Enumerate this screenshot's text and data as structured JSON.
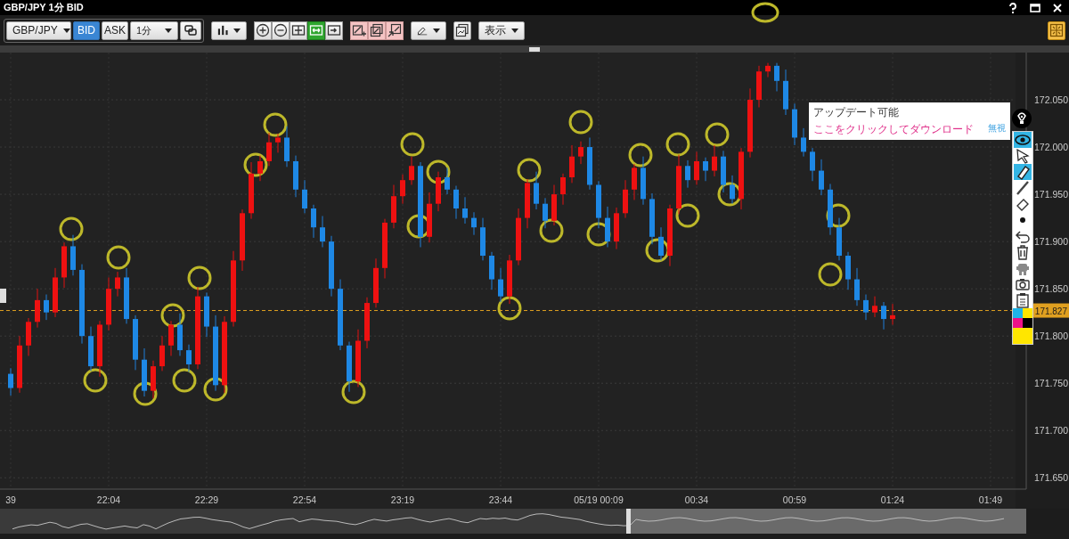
{
  "window": {
    "title": "GBP/JPY 1分 BID"
  },
  "toolbar": {
    "symbol": "GBP/JPY",
    "price_sides": [
      {
        "label": "BID",
        "selected": true
      },
      {
        "label": "ASK",
        "selected": false
      }
    ],
    "timeframe": "1分",
    "view_buttons": [
      {
        "selected": false
      },
      {
        "selected": false
      },
      {
        "selected": false
      },
      {
        "selected": true
      },
      {
        "selected": false
      }
    ],
    "display_menu": "表示"
  },
  "notification": {
    "title": "アップデート可能",
    "link": "ここをクリックしてダウンロード",
    "dismiss": "無視"
  },
  "drawing_tools": [
    {
      "selected": true
    },
    {
      "selected": false
    },
    {
      "selected": true
    },
    {
      "selected": false
    },
    {
      "selected": false
    },
    {
      "selected": false
    },
    {
      "selected": false
    },
    {
      "selected": false
    },
    {
      "selected": false
    },
    {
      "selected": false
    },
    {
      "selected": false
    }
  ],
  "chart": {
    "chart_data": {
      "type": "candlestick",
      "ylim": [
        171.638,
        172.1
      ],
      "grid": true,
      "ref_lines": [
        {
          "axis": "y",
          "value": 171.827,
          "label": "171.827",
          "color": "#e0a020"
        }
      ],
      "categories": [
        "39",
        null,
        null,
        null,
        null,
        null,
        null,
        null,
        null,
        null,
        null,
        "22:04",
        null,
        null,
        null,
        null,
        null,
        null,
        null,
        null,
        null,
        null,
        "22:29",
        null,
        null,
        null,
        null,
        null,
        null,
        null,
        null,
        null,
        null,
        "22:54",
        null,
        null,
        null,
        null,
        null,
        null,
        null,
        null,
        null,
        null,
        "23:19",
        null,
        null,
        null,
        null,
        null,
        null,
        null,
        null,
        null,
        null,
        "23:44",
        null,
        null,
        null,
        null,
        null,
        null,
        null,
        null,
        null,
        null,
        "05/19 00:09",
        null,
        null,
        null,
        null,
        null,
        null,
        null,
        null,
        null,
        null,
        "00:34",
        null,
        null,
        null,
        null,
        null,
        null,
        null,
        null,
        null,
        null,
        "00:59",
        null,
        null,
        null,
        null,
        null,
        null,
        null,
        null,
        null,
        null,
        "01:24",
        null,
        null,
        null,
        null,
        null,
        null,
        null,
        null,
        null,
        null,
        "01:49"
      ],
      "yticks": [
        {
          "value": 172.05,
          "label": "172.050"
        },
        {
          "value": 172.0,
          "label": "172.000"
        },
        {
          "value": 171.95,
          "label": "171.950"
        },
        {
          "value": 171.9,
          "label": "171.900"
        },
        {
          "value": 171.85,
          "label": "171.850"
        },
        {
          "value": 171.8,
          "label": "171.800"
        },
        {
          "value": 171.75,
          "label": "171.750"
        },
        {
          "value": 171.7,
          "label": "171.700"
        },
        {
          "value": 171.65,
          "label": "171.650"
        }
      ],
      "ohlc": [
        [
          171.76,
          171.766,
          171.737,
          171.745
        ],
        [
          171.745,
          171.8,
          171.74,
          171.79
        ],
        [
          171.79,
          171.819,
          171.779,
          171.815
        ],
        [
          171.815,
          171.85,
          171.809,
          171.838
        ],
        [
          171.838,
          171.844,
          171.817,
          171.825
        ],
        [
          171.825,
          171.872,
          171.82,
          171.862
        ],
        [
          171.862,
          171.899,
          171.851,
          171.895
        ],
        [
          171.895,
          171.907,
          171.864,
          171.87
        ],
        [
          171.87,
          171.876,
          171.792,
          171.8
        ],
        [
          171.8,
          171.81,
          171.763,
          171.768
        ],
        [
          171.768,
          171.816,
          171.757,
          171.812
        ],
        [
          171.812,
          171.862,
          171.806,
          171.85
        ],
        [
          171.85,
          171.868,
          171.842,
          171.862
        ],
        [
          171.862,
          171.872,
          171.813,
          171.818
        ],
        [
          171.818,
          171.822,
          171.764,
          171.775
        ],
        [
          171.775,
          171.787,
          171.736,
          171.742
        ],
        [
          171.742,
          171.774,
          171.734,
          171.768
        ],
        [
          171.768,
          171.8,
          171.763,
          171.79
        ],
        [
          171.79,
          171.816,
          171.779,
          171.812
        ],
        [
          171.812,
          171.824,
          171.779,
          171.785
        ],
        [
          171.785,
          171.791,
          171.762,
          171.77
        ],
        [
          171.77,
          171.852,
          171.765,
          171.842
        ],
        [
          171.842,
          171.846,
          171.799,
          171.81
        ],
        [
          171.81,
          171.822,
          171.742,
          171.748
        ],
        [
          171.748,
          171.821,
          171.74,
          171.815
        ],
        [
          171.815,
          171.89,
          171.81,
          171.88
        ],
        [
          171.88,
          171.934,
          171.869,
          171.93
        ],
        [
          171.93,
          171.984,
          171.924,
          171.972
        ],
        [
          171.972,
          171.991,
          171.964,
          171.985
        ],
        [
          171.985,
          172.015,
          171.98,
          172.005
        ],
        [
          172.005,
          172.014,
          171.994,
          172.01
        ],
        [
          172.01,
          172.022,
          171.979,
          171.985
        ],
        [
          171.985,
          171.991,
          171.947,
          171.955
        ],
        [
          171.955,
          171.965,
          171.93,
          171.935
        ],
        [
          171.935,
          171.939,
          171.904,
          171.915
        ],
        [
          171.915,
          171.927,
          171.894,
          171.9
        ],
        [
          171.9,
          171.906,
          171.842,
          171.85
        ],
        [
          171.85,
          171.86,
          171.785,
          171.79
        ],
        [
          171.79,
          171.794,
          171.741,
          171.752
        ],
        [
          171.752,
          171.807,
          171.746,
          171.795
        ],
        [
          171.795,
          171.841,
          171.787,
          171.835
        ],
        [
          171.835,
          171.882,
          171.83,
          171.872
        ],
        [
          171.872,
          171.924,
          171.861,
          171.92
        ],
        [
          171.92,
          171.96,
          171.914,
          171.948
        ],
        [
          171.948,
          171.971,
          171.94,
          171.965
        ],
        [
          171.965,
          171.99,
          171.96,
          171.98
        ],
        [
          171.98,
          171.984,
          171.894,
          171.905
        ],
        [
          171.905,
          171.952,
          171.899,
          171.94
        ],
        [
          171.94,
          171.974,
          171.932,
          171.968
        ],
        [
          171.968,
          171.978,
          171.95,
          171.955
        ],
        [
          171.955,
          171.959,
          171.924,
          171.935
        ],
        [
          171.935,
          171.947,
          171.919,
          171.925
        ],
        [
          171.925,
          171.931,
          171.907,
          171.915
        ],
        [
          171.915,
          171.925,
          171.88,
          171.885
        ],
        [
          171.885,
          171.889,
          171.849,
          171.86
        ],
        [
          171.86,
          171.872,
          171.836,
          171.842
        ],
        [
          171.842,
          171.886,
          171.834,
          171.88
        ],
        [
          171.88,
          171.935,
          171.875,
          171.925
        ],
        [
          171.925,
          171.966,
          171.914,
          171.962
        ],
        [
          171.962,
          171.974,
          171.934,
          171.94
        ],
        [
          171.94,
          171.946,
          171.914,
          171.922
        ],
        [
          171.922,
          171.96,
          171.917,
          171.95
        ],
        [
          171.95,
          171.972,
          171.939,
          171.968
        ],
        [
          171.968,
          172.002,
          171.962,
          171.99
        ],
        [
          171.99,
          172.006,
          171.982,
          172.0
        ],
        [
          172.0,
          172.01,
          171.955,
          171.96
        ],
        [
          171.96,
          171.964,
          171.914,
          171.925
        ],
        [
          171.925,
          171.937,
          171.894,
          171.9
        ],
        [
          171.9,
          171.936,
          171.892,
          171.93
        ],
        [
          171.93,
          171.965,
          171.925,
          171.955
        ],
        [
          171.955,
          171.982,
          171.944,
          171.978
        ],
        [
          171.978,
          171.99,
          171.939,
          171.945
        ],
        [
          171.945,
          171.951,
          171.897,
          171.905
        ],
        [
          171.905,
          171.915,
          171.88,
          171.885
        ],
        [
          171.885,
          171.939,
          171.874,
          171.935
        ],
        [
          171.935,
          171.992,
          171.929,
          171.98
        ],
        [
          171.98,
          171.986,
          171.957,
          171.965
        ],
        [
          171.965,
          171.995,
          171.96,
          171.985
        ],
        [
          171.985,
          171.989,
          171.964,
          171.975
        ],
        [
          171.975,
          172.002,
          171.969,
          171.99
        ],
        [
          171.99,
          171.996,
          171.952,
          171.96
        ],
        [
          171.96,
          171.97,
          171.94,
          171.945
        ],
        [
          171.945,
          171.999,
          171.934,
          171.995
        ],
        [
          171.995,
          172.062,
          171.989,
          172.05
        ],
        [
          172.05,
          172.086,
          172.042,
          172.08
        ],
        [
          172.08,
          172.089,
          172.074,
          172.086
        ],
        [
          172.086,
          172.089,
          172.059,
          172.07
        ],
        [
          172.07,
          172.082,
          172.034,
          172.04
        ],
        [
          172.04,
          172.046,
          172.002,
          172.01
        ],
        [
          172.01,
          172.02,
          171.99,
          171.995
        ],
        [
          171.995,
          171.999,
          171.964,
          171.975
        ],
        [
          171.975,
          171.987,
          171.949,
          171.955
        ],
        [
          171.955,
          171.961,
          171.907,
          171.915
        ],
        [
          171.915,
          171.925,
          171.88,
          171.885
        ],
        [
          171.885,
          171.889,
          171.849,
          171.86
        ],
        [
          171.86,
          171.872,
          171.832,
          171.838
        ],
        [
          171.838,
          171.844,
          171.817,
          171.825
        ],
        [
          171.825,
          171.842,
          171.82,
          171.832
        ],
        [
          171.832,
          171.836,
          171.807,
          171.818
        ],
        [
          171.818,
          171.834,
          171.812,
          171.822
        ],
        null,
        null,
        null,
        null,
        null,
        null,
        null,
        null,
        null,
        null,
        null
      ]
    }
  }
}
